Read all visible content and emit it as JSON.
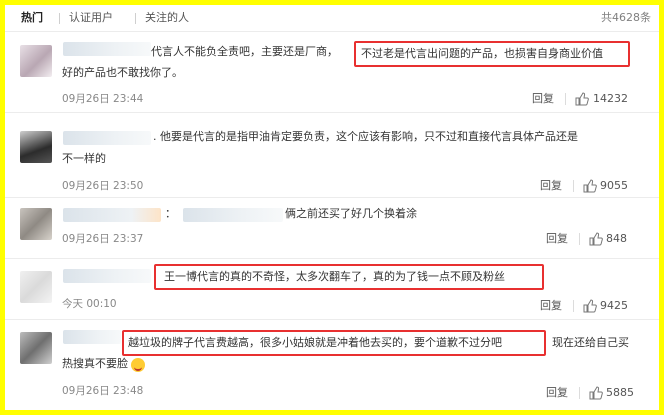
{
  "tabs": {
    "hot": "热门",
    "verified": "认证用户",
    "following": "关注的人"
  },
  "total": "共4628条",
  "comments": [
    {
      "line1_pre": "代言人不能负全责吧，主要还是厂商，",
      "line1_hl": "不过老是代言出问题的产品，也损害自身商业价值",
      "line2": "好的产品也不敢找你了。",
      "time": "09月26日 23:44",
      "reply": "回复",
      "likes": "14232"
    },
    {
      "line1": ". 他要是代言的是指甲油肯定要负责，这个应该有影响，只不过和直接代言具体产品还是",
      "line2": "不一样的",
      "time": "09月26日 23:50",
      "reply": "回复",
      "likes": "9055"
    },
    {
      "colon": "：",
      "line1": "俩之前还买了好几个换着涂",
      "time": "09月26日 23:37",
      "reply": "回复",
      "likes": "848"
    },
    {
      "line1_hl": "王一博代言的真的不奇怪，太多次翻车了，真的为了钱一点不顾及粉丝",
      "time": "今天 00:10",
      "reply": "回复",
      "likes": "9425"
    },
    {
      "line1_hl": "越垃圾的牌子代言费越高，很多小姑娘就是冲着他去买的，要个道歉不过分吧",
      "line1_post": "现在还给自己买",
      "line2": "热搜真不要脸",
      "time": "09月26日 23:48",
      "reply": "回复",
      "likes": "5885"
    }
  ]
}
